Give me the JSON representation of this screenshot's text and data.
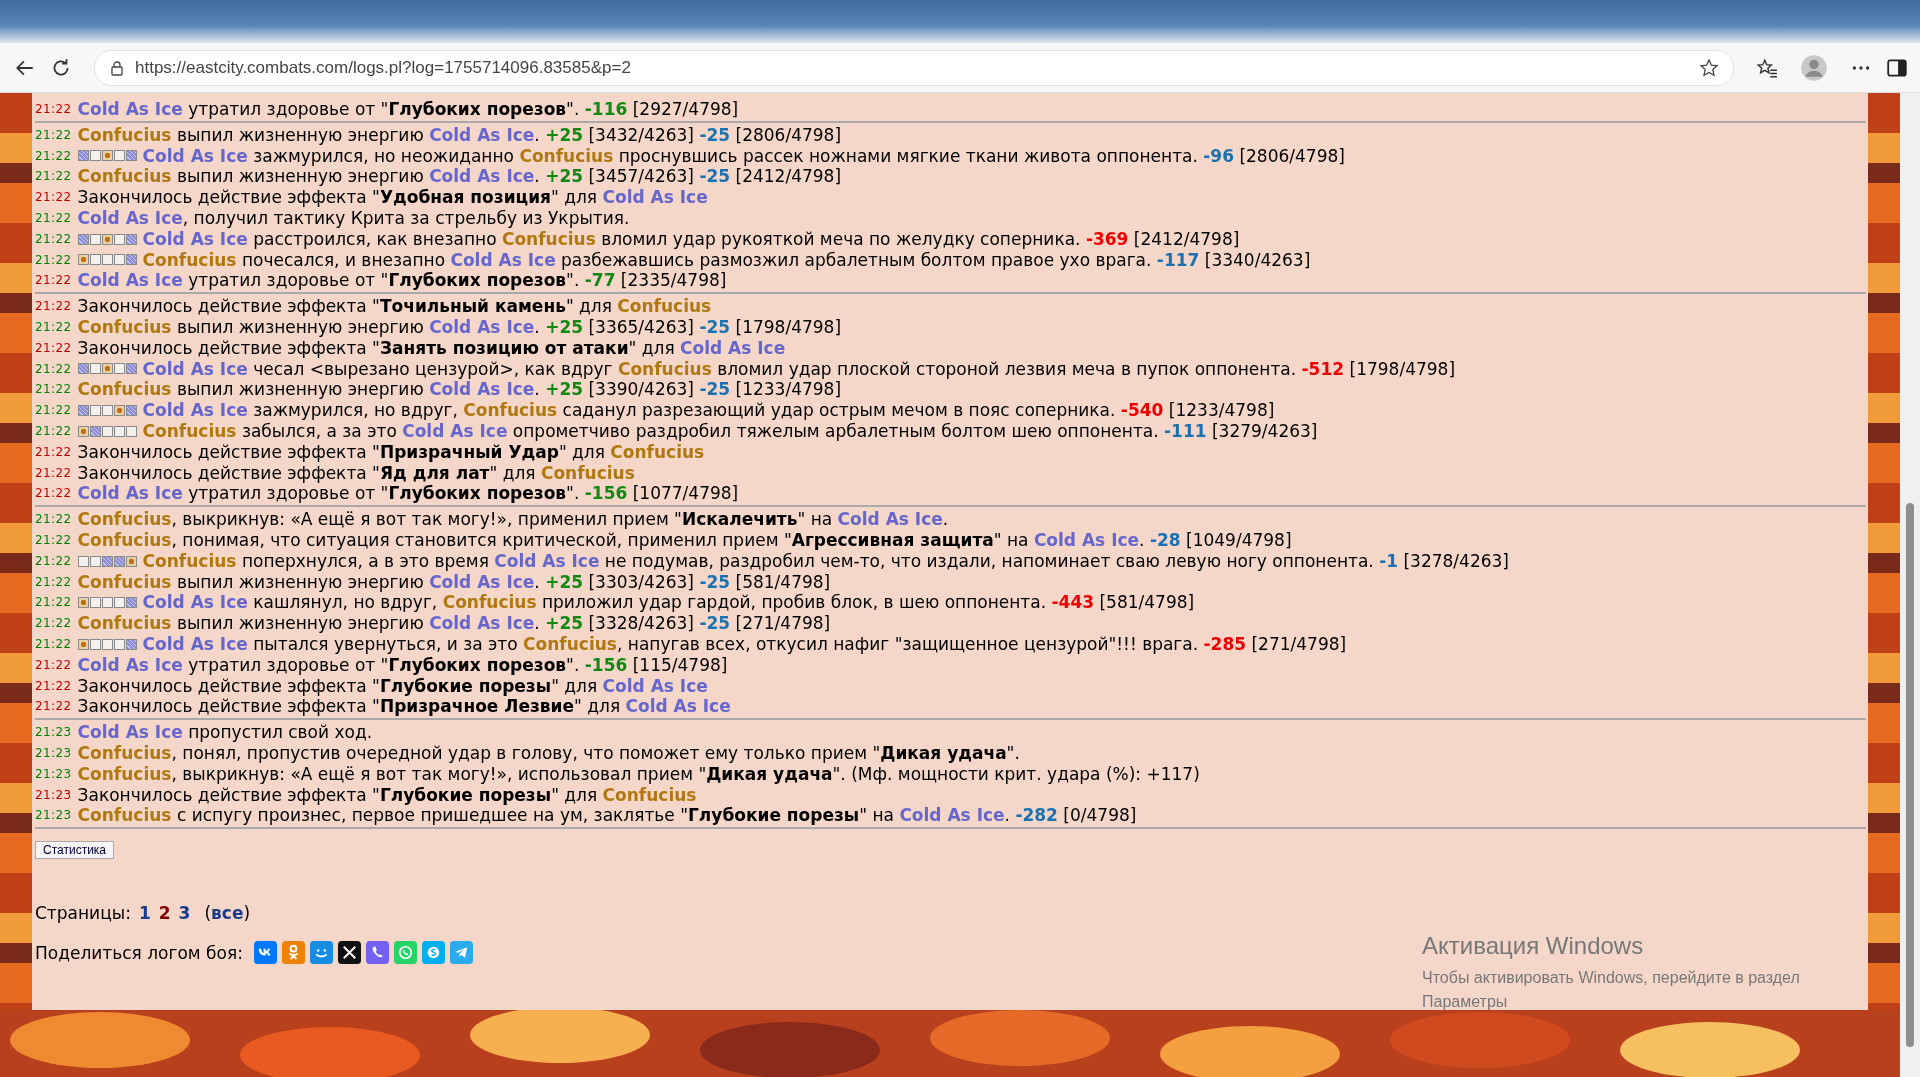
{
  "browser": {
    "url": "https://eastcity.combats.com/logs.pl?log=1755714096.83585&p=2"
  },
  "log": {
    "groups": [
      {
        "entries": [
          {
            "time": "21:22",
            "color": "#c00000",
            "segments": [
              {
                "kind": "fighter1",
                "text": "Cold As Ice"
              },
              {
                "kind": "plain",
                "text": " утратил здоровье от \""
              },
              {
                "kind": "effect",
                "text": "Глубоких порезов"
              },
              {
                "kind": "plain",
                "text": "\". "
              },
              {
                "kind": "heal",
                "text": "-116"
              },
              {
                "kind": "plain",
                "text": " [2927/4798]"
              }
            ]
          }
        ]
      },
      {
        "entries": [
          {
            "time": "21:22",
            "color": "#008000",
            "segments": [
              {
                "kind": "fighter2",
                "text": "Confucius"
              },
              {
                "kind": "plain",
                "text": " выпил жизненную энергию "
              },
              {
                "kind": "fighter1",
                "text": "Cold As Ice"
              },
              {
                "kind": "plain",
                "text": ". "
              },
              {
                "kind": "heal",
                "text": "+25"
              },
              {
                "kind": "plain",
                "text": " [3432/4263] "
              },
              {
                "kind": "drain",
                "text": "-25"
              },
              {
                "kind": "plain",
                "text": " [2806/4798]"
              }
            ]
          },
          {
            "time": "21:22",
            "color": "#008000",
            "zones": [
              {
                "kind": "hatch"
              },
              {
                "kind": "empty"
              },
              {
                "kind": "dot"
              },
              {
                "kind": "empty"
              },
              {
                "kind": "hatch"
              }
            ],
            "segments": [
              {
                "kind": "fighter1",
                "text": "Cold As Ice"
              },
              {
                "kind": "plain",
                "text": " зажмурился, но неожиданно "
              },
              {
                "kind": "fighter2",
                "text": "Confucius"
              },
              {
                "kind": "plain",
                "text": " проснувшись рассек ножнами мягкие ткани живота оппонента. "
              },
              {
                "kind": "drain",
                "text": "-96"
              },
              {
                "kind": "plain",
                "text": " [2806/4798]"
              }
            ]
          },
          {
            "time": "21:22",
            "color": "#008000",
            "segments": [
              {
                "kind": "fighter2",
                "text": "Confucius"
              },
              {
                "kind": "plain",
                "text": " выпил жизненную энергию "
              },
              {
                "kind": "fighter1",
                "text": "Cold As Ice"
              },
              {
                "kind": "plain",
                "text": ". "
              },
              {
                "kind": "heal",
                "text": "+25"
              },
              {
                "kind": "plain",
                "text": " [3457/4263] "
              },
              {
                "kind": "drain",
                "text": "-25"
              },
              {
                "kind": "plain",
                "text": " [2412/4798]"
              }
            ]
          },
          {
            "time": "21:22",
            "color": "#c00000",
            "segments": [
              {
                "kind": "plain",
                "text": "Закончилось действие эффекта \""
              },
              {
                "kind": "effect",
                "text": "Удобная позиция"
              },
              {
                "kind": "plain",
                "text": "\" для "
              },
              {
                "kind": "fighter1",
                "text": "Cold As Ice"
              }
            ]
          },
          {
            "time": "21:22",
            "color": "#008000",
            "segments": [
              {
                "kind": "fighter1",
                "text": "Cold As Ice"
              },
              {
                "kind": "plain",
                "text": ", получил тактику Крита за стрельбу из Укрытия."
              }
            ]
          },
          {
            "time": "21:22",
            "color": "#008000",
            "zones": [
              {
                "kind": "hatch"
              },
              {
                "kind": "empty"
              },
              {
                "kind": "dot"
              },
              {
                "kind": "empty"
              },
              {
                "kind": "hatch"
              }
            ],
            "segments": [
              {
                "kind": "fighter1",
                "text": "Cold As Ice"
              },
              {
                "kind": "plain",
                "text": " расстроился, как внезапно "
              },
              {
                "kind": "fighter2",
                "text": "Confucius"
              },
              {
                "kind": "plain",
                "text": " вломил удар рукояткой меча по желудку соперника. "
              },
              {
                "kind": "hit",
                "text": "-369"
              },
              {
                "kind": "plain",
                "text": " [2412/4798]"
              }
            ]
          },
          {
            "time": "21:22",
            "color": "#008000",
            "zones": [
              {
                "kind": "dot"
              },
              {
                "kind": "empty"
              },
              {
                "kind": "empty"
              },
              {
                "kind": "empty"
              },
              {
                "kind": "hatch"
              }
            ],
            "segments": [
              {
                "kind": "fighter2",
                "text": "Confucius"
              },
              {
                "kind": "plain",
                "text": " почесался, и внезапно "
              },
              {
                "kind": "fighter1",
                "text": "Cold As Ice"
              },
              {
                "kind": "plain",
                "text": " разбежавшись размозжил арбалетным болтом правое ухо врага. "
              },
              {
                "kind": "drain",
                "text": "-117"
              },
              {
                "kind": "plain",
                "text": " [3340/4263]"
              }
            ]
          },
          {
            "time": "21:22",
            "color": "#c00000",
            "segments": [
              {
                "kind": "fighter1",
                "text": "Cold As Ice"
              },
              {
                "kind": "plain",
                "text": " утратил здоровье от \""
              },
              {
                "kind": "effect",
                "text": "Глубоких порезов"
              },
              {
                "kind": "plain",
                "text": "\". "
              },
              {
                "kind": "heal",
                "text": "-77"
              },
              {
                "kind": "plain",
                "text": " [2335/4798]"
              }
            ]
          }
        ]
      },
      {
        "entries": [
          {
            "time": "21:22",
            "color": "#c00000",
            "segments": [
              {
                "kind": "plain",
                "text": "Закончилось действие эффекта \""
              },
              {
                "kind": "effect",
                "text": "Точильный камень"
              },
              {
                "kind": "plain",
                "text": "\" для "
              },
              {
                "kind": "fighter2",
                "text": "Confucius"
              }
            ]
          },
          {
            "time": "21:22",
            "color": "#008000",
            "segments": [
              {
                "kind": "fighter2",
                "text": "Confucius"
              },
              {
                "kind": "plain",
                "text": " выпил жизненную энергию "
              },
              {
                "kind": "fighter1",
                "text": "Cold As Ice"
              },
              {
                "kind": "plain",
                "text": ". "
              },
              {
                "kind": "heal",
                "text": "+25"
              },
              {
                "kind": "plain",
                "text": " [3365/4263] "
              },
              {
                "kind": "drain",
                "text": "-25"
              },
              {
                "kind": "plain",
                "text": " [1798/4798]"
              }
            ]
          },
          {
            "time": "21:22",
            "color": "#c00000",
            "segments": [
              {
                "kind": "plain",
                "text": "Закончилось действие эффекта \""
              },
              {
                "kind": "effect",
                "text": "Занять позицию от атаки"
              },
              {
                "kind": "plain",
                "text": "\" для "
              },
              {
                "kind": "fighter1",
                "text": "Cold As Ice"
              }
            ]
          },
          {
            "time": "21:22",
            "color": "#008000",
            "zones": [
              {
                "kind": "hatch"
              },
              {
                "kind": "empty"
              },
              {
                "kind": "dot"
              },
              {
                "kind": "empty"
              },
              {
                "kind": "hatch"
              }
            ],
            "segments": [
              {
                "kind": "fighter1",
                "text": "Cold As Ice"
              },
              {
                "kind": "plain",
                "text": " чесал <вырезано цензурой>, как вдруг "
              },
              {
                "kind": "fighter2",
                "text": "Confucius"
              },
              {
                "kind": "plain",
                "text": " вломил удар плоской стороной лезвия меча в пупок оппонента. "
              },
              {
                "kind": "hit",
                "text": "-512"
              },
              {
                "kind": "plain",
                "text": " [1798/4798]"
              }
            ]
          },
          {
            "time": "21:22",
            "color": "#008000",
            "segments": [
              {
                "kind": "fighter2",
                "text": "Confucius"
              },
              {
                "kind": "plain",
                "text": " выпил жизненную энергию "
              },
              {
                "kind": "fighter1",
                "text": "Cold As Ice"
              },
              {
                "kind": "plain",
                "text": ". "
              },
              {
                "kind": "heal",
                "text": "+25"
              },
              {
                "kind": "plain",
                "text": " [3390/4263] "
              },
              {
                "kind": "drain",
                "text": "-25"
              },
              {
                "kind": "plain",
                "text": " [1233/4798]"
              }
            ]
          },
          {
            "time": "21:22",
            "color": "#008000",
            "zones": [
              {
                "kind": "hatch"
              },
              {
                "kind": "empty"
              },
              {
                "kind": "empty"
              },
              {
                "kind": "dot"
              },
              {
                "kind": "hatch"
              }
            ],
            "segments": [
              {
                "kind": "fighter1",
                "text": "Cold As Ice"
              },
              {
                "kind": "plain",
                "text": " зажмурился, но вдруг, "
              },
              {
                "kind": "fighter2",
                "text": "Confucius"
              },
              {
                "kind": "plain",
                "text": " саданул разрезающий удар острым мечом в пояс соперника. "
              },
              {
                "kind": "hit",
                "text": "-540"
              },
              {
                "kind": "plain",
                "text": " [1233/4798]"
              }
            ]
          },
          {
            "time": "21:22",
            "color": "#008000",
            "zones": [
              {
                "kind": "dot"
              },
              {
                "kind": "hatch"
              },
              {
                "kind": "empty"
              },
              {
                "kind": "empty"
              },
              {
                "kind": "empty"
              }
            ],
            "segments": [
              {
                "kind": "fighter2",
                "text": "Confucius"
              },
              {
                "kind": "plain",
                "text": " забылся, а за это "
              },
              {
                "kind": "fighter1",
                "text": "Cold As Ice"
              },
              {
                "kind": "plain",
                "text": " опрометчиво раздробил тяжелым арбалетным болтом шею оппонента. "
              },
              {
                "kind": "drain",
                "text": "-111"
              },
              {
                "kind": "plain",
                "text": " [3279/4263]"
              }
            ]
          },
          {
            "time": "21:22",
            "color": "#c00000",
            "segments": [
              {
                "kind": "plain",
                "text": "Закончилось действие эффекта \""
              },
              {
                "kind": "effect",
                "text": "Призрачный Удар"
              },
              {
                "kind": "plain",
                "text": "\" для "
              },
              {
                "kind": "fighter2",
                "text": "Confucius"
              }
            ]
          },
          {
            "time": "21:22",
            "color": "#c00000",
            "segments": [
              {
                "kind": "plain",
                "text": "Закончилось действие эффекта \""
              },
              {
                "kind": "effect",
                "text": "Яд для лат"
              },
              {
                "kind": "plain",
                "text": "\" для "
              },
              {
                "kind": "fighter2",
                "text": "Confucius"
              }
            ]
          },
          {
            "time": "21:22",
            "color": "#c00000",
            "segments": [
              {
                "kind": "fighter1",
                "text": "Cold As Ice"
              },
              {
                "kind": "plain",
                "text": " утратил здоровье от \""
              },
              {
                "kind": "effect",
                "text": "Глубоких порезов"
              },
              {
                "kind": "plain",
                "text": "\". "
              },
              {
                "kind": "heal",
                "text": "-156"
              },
              {
                "kind": "plain",
                "text": " [1077/4798]"
              }
            ]
          }
        ]
      },
      {
        "entries": [
          {
            "time": "21:22",
            "color": "#008000",
            "segments": [
              {
                "kind": "fighter2",
                "text": "Confucius"
              },
              {
                "kind": "plain",
                "text": ", выкрикнув: «А ещё я вот так могу!», применил прием \""
              },
              {
                "kind": "effect",
                "text": "Искалечить"
              },
              {
                "kind": "plain",
                "text": "\" на "
              },
              {
                "kind": "fighter1",
                "text": "Cold As Ice"
              },
              {
                "kind": "plain",
                "text": "."
              }
            ]
          },
          {
            "time": "21:22",
            "color": "#008000",
            "segments": [
              {
                "kind": "fighter2",
                "text": "Confucius"
              },
              {
                "kind": "plain",
                "text": ", понимая, что ситуация становится критической, применил прием \""
              },
              {
                "kind": "effect",
                "text": "Агрессивная защита"
              },
              {
                "kind": "plain",
                "text": "\" на "
              },
              {
                "kind": "fighter1",
                "text": "Cold As Ice"
              },
              {
                "kind": "plain",
                "text": ". "
              },
              {
                "kind": "drain",
                "text": "-28"
              },
              {
                "kind": "plain",
                "text": " [1049/4798]"
              }
            ]
          },
          {
            "time": "21:22",
            "color": "#008000",
            "zones": [
              {
                "kind": "empty"
              },
              {
                "kind": "empty"
              },
              {
                "kind": "hatch"
              },
              {
                "kind": "hatch"
              },
              {
                "kind": "dot"
              }
            ],
            "segments": [
              {
                "kind": "fighter2",
                "text": "Confucius"
              },
              {
                "kind": "plain",
                "text": " поперхнулся, а в это время "
              },
              {
                "kind": "fighter1",
                "text": "Cold As Ice"
              },
              {
                "kind": "plain",
                "text": " не подумав, раздробил чем-то, что издали, напоминает сваю левую ногу оппонента. "
              },
              {
                "kind": "drain",
                "text": "-1"
              },
              {
                "kind": "plain",
                "text": " [3278/4263]"
              }
            ]
          },
          {
            "time": "21:22",
            "color": "#008000",
            "segments": [
              {
                "kind": "fighter2",
                "text": "Confucius"
              },
              {
                "kind": "plain",
                "text": " выпил жизненную энергию "
              },
              {
                "kind": "fighter1",
                "text": "Cold As Ice"
              },
              {
                "kind": "plain",
                "text": ". "
              },
              {
                "kind": "heal",
                "text": "+25"
              },
              {
                "kind": "plain",
                "text": " [3303/4263] "
              },
              {
                "kind": "drain",
                "text": "-25"
              },
              {
                "kind": "plain",
                "text": " [581/4798]"
              }
            ]
          },
          {
            "time": "21:22",
            "color": "#008000",
            "zones": [
              {
                "kind": "dot"
              },
              {
                "kind": "empty"
              },
              {
                "kind": "empty"
              },
              {
                "kind": "empty"
              },
              {
                "kind": "hatch"
              }
            ],
            "segments": [
              {
                "kind": "fighter1",
                "text": "Cold As Ice"
              },
              {
                "kind": "plain",
                "text": " кашлянул, но вдруг, "
              },
              {
                "kind": "fighter2",
                "text": "Confucius"
              },
              {
                "kind": "plain",
                "text": " приложил удар гардой, пробив блок, в шею оппонента. "
              },
              {
                "kind": "hit",
                "text": "-443"
              },
              {
                "kind": "plain",
                "text": " [581/4798]"
              }
            ]
          },
          {
            "time": "21:22",
            "color": "#008000",
            "segments": [
              {
                "kind": "fighter2",
                "text": "Confucius"
              },
              {
                "kind": "plain",
                "text": " выпил жизненную энергию "
              },
              {
                "kind": "fighter1",
                "text": "Cold As Ice"
              },
              {
                "kind": "plain",
                "text": ". "
              },
              {
                "kind": "heal",
                "text": "+25"
              },
              {
                "kind": "plain",
                "text": " [3328/4263] "
              },
              {
                "kind": "drain",
                "text": "-25"
              },
              {
                "kind": "plain",
                "text": " [271/4798]"
              }
            ]
          },
          {
            "time": "21:22",
            "color": "#008000",
            "zones": [
              {
                "kind": "dot"
              },
              {
                "kind": "empty"
              },
              {
                "kind": "empty"
              },
              {
                "kind": "empty"
              },
              {
                "kind": "hatch"
              }
            ],
            "segments": [
              {
                "kind": "fighter1",
                "text": "Cold As Ice"
              },
              {
                "kind": "plain",
                "text": " пытался увернуться, и за это "
              },
              {
                "kind": "fighter2",
                "text": "Confucius"
              },
              {
                "kind": "plain",
                "text": ", напугав всех, откусил нафиг \"защищенное цензурой\"!!! врага. "
              },
              {
                "kind": "hit",
                "text": "-285"
              },
              {
                "kind": "plain",
                "text": " [271/4798]"
              }
            ]
          },
          {
            "time": "21:22",
            "color": "#c00000",
            "segments": [
              {
                "kind": "fighter1",
                "text": "Cold As Ice"
              },
              {
                "kind": "plain",
                "text": " утратил здоровье от \""
              },
              {
                "kind": "effect",
                "text": "Глубоких порезов"
              },
              {
                "kind": "plain",
                "text": "\". "
              },
              {
                "kind": "heal",
                "text": "-156"
              },
              {
                "kind": "plain",
                "text": " [115/4798]"
              }
            ]
          },
          {
            "time": "21:22",
            "color": "#c00000",
            "segments": [
              {
                "kind": "plain",
                "text": "Закончилось действие эффекта \""
              },
              {
                "kind": "effect",
                "text": "Глубокие порезы"
              },
              {
                "kind": "plain",
                "text": "\" для "
              },
              {
                "kind": "fighter1",
                "text": "Cold As Ice"
              }
            ]
          },
          {
            "time": "21:22",
            "color": "#c00000",
            "segments": [
              {
                "kind": "plain",
                "text": "Закончилось действие эффекта \""
              },
              {
                "kind": "effect",
                "text": "Призрачное Лезвие"
              },
              {
                "kind": "plain",
                "text": "\" для "
              },
              {
                "kind": "fighter1",
                "text": "Cold As Ice"
              }
            ]
          }
        ]
      },
      {
        "entries": [
          {
            "time": "21:23",
            "color": "#008000",
            "segments": [
              {
                "kind": "fighter1",
                "text": "Cold As Ice"
              },
              {
                "kind": "plain",
                "text": " пропустил свой ход."
              }
            ]
          },
          {
            "time": "21:23",
            "color": "#008000",
            "segments": [
              {
                "kind": "fighter2",
                "text": "Confucius"
              },
              {
                "kind": "plain",
                "text": ", понял, пропустив очередной удар в голову, что поможет ему только прием \""
              },
              {
                "kind": "effect",
                "text": "Дикая удача"
              },
              {
                "kind": "plain",
                "text": "\"."
              }
            ]
          },
          {
            "time": "21:23",
            "color": "#008000",
            "segments": [
              {
                "kind": "fighter2",
                "text": "Confucius"
              },
              {
                "kind": "plain",
                "text": ", выкрикнув: «А ещё я вот так могу!», использовал прием \""
              },
              {
                "kind": "effect",
                "text": "Дикая удача"
              },
              {
                "kind": "plain",
                "text": "\". (Мф. мощности крит. удара (%): +117)"
              }
            ]
          },
          {
            "time": "21:23",
            "color": "#c00000",
            "segments": [
              {
                "kind": "plain",
                "text": "Закончилось действие эффекта \""
              },
              {
                "kind": "effect",
                "text": "Глубокие порезы"
              },
              {
                "kind": "plain",
                "text": "\" для "
              },
              {
                "kind": "fighter2",
                "text": "Confucius"
              }
            ]
          },
          {
            "time": "21:23",
            "color": "#008000",
            "segments": [
              {
                "kind": "fighter2",
                "text": "Confucius"
              },
              {
                "kind": "plain",
                "text": " с испугу произнес, первое пришедшее на ум, заклятье \""
              },
              {
                "kind": "effect",
                "text": "Глубокие порезы"
              },
              {
                "kind": "plain",
                "text": "\" на "
              },
              {
                "kind": "fighter1",
                "text": "Cold As Ice"
              },
              {
                "kind": "plain",
                "text": ". "
              },
              {
                "kind": "drain",
                "text": "-282"
              },
              {
                "kind": "plain",
                "text": " [0/4798]"
              }
            ]
          }
        ]
      }
    ]
  },
  "stats_button": "Статистика",
  "pages": {
    "label": "Страницы:",
    "items": [
      {
        "label": "1",
        "selected": false
      },
      {
        "label": "2",
        "selected": true
      },
      {
        "label": "3",
        "selected": false
      }
    ],
    "open_paren": "(",
    "all": "все",
    "close_paren": ")"
  },
  "share": {
    "label": "Поделиться логом боя:",
    "icons": [
      {
        "kind": "vk"
      },
      {
        "kind": "ok"
      },
      {
        "kind": "mail"
      },
      {
        "kind": "x"
      },
      {
        "kind": "viber"
      },
      {
        "kind": "whatsapp"
      },
      {
        "kind": "skype"
      },
      {
        "kind": "telegram"
      }
    ]
  },
  "activation": {
    "title": "Активация Windows",
    "hint": "Чтобы активировать Windows, перейдите в раздел Параметры"
  }
}
